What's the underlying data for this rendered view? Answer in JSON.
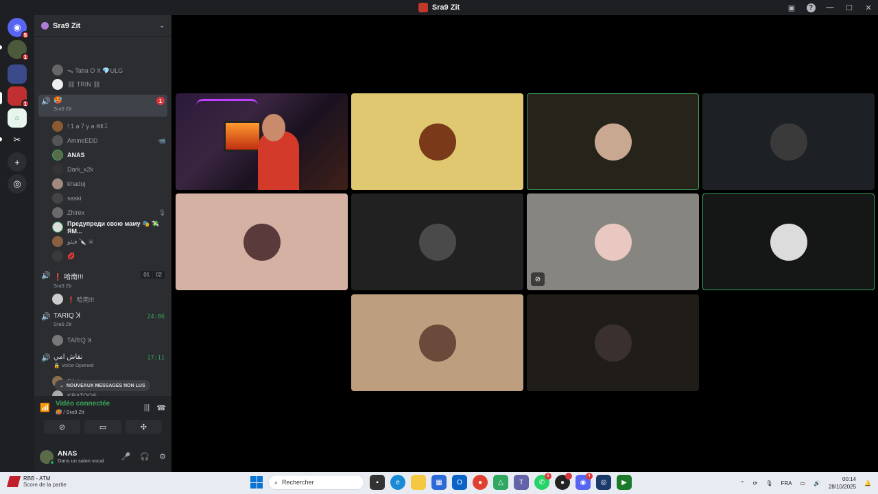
{
  "window": {
    "title": "Sra9 Zit"
  },
  "servers": {
    "items": [
      {
        "name": "discord-home-icon",
        "badge": "5",
        "color": "#5865f2"
      },
      {
        "name": "server-1",
        "badge": "1",
        "color": "#4a5a3a"
      },
      {
        "name": "server-2",
        "badge": "",
        "color": "#3b4a8a"
      },
      {
        "name": "server-3",
        "badge": "1",
        "color": "#c03030"
      },
      {
        "name": "server-4",
        "badge": "",
        "color": "#e8f5ee"
      },
      {
        "name": "server-5",
        "badge": "",
        "color": "#ffffff"
      }
    ]
  },
  "guild": {
    "name": "Sra9 Zit"
  },
  "channels": {
    "top_users": [
      {
        "name": "ᯓ Taha O X 💎ULG"
      },
      {
        "name": "⛓ TRIN ⛓"
      }
    ],
    "current": {
      "emoji": "🥵",
      "sub": "Sra9 Zit",
      "badge": "1"
    },
    "current_users": [
      {
        "name": "! 1 a 7 y a   ꕕꔪꔊ",
        "bold": false,
        "right": ""
      },
      {
        "name": "AmineEDD",
        "bold": false,
        "right": "📹"
      },
      {
        "name": "ANAS",
        "bold": true,
        "right": ""
      },
      {
        "name": "Dark_x2k",
        "bold": false,
        "right": ""
      },
      {
        "name": "khadoj",
        "bold": false,
        "right": ""
      },
      {
        "name": "saski",
        "bold": false,
        "right": ""
      },
      {
        "name": "Zhirex",
        "bold": false,
        "right": "🎙"
      },
      {
        "name": "Предупреди свою маму 🎭 💸 ЯМ...",
        "bold": true,
        "right": ""
      },
      {
        "name": "فيتو 🔪 ☠",
        "bold": false,
        "right": ""
      },
      {
        "name": "💋",
        "bold": false,
        "right": ""
      }
    ],
    "ch2": {
      "name": "❗ 哈南!!!",
      "sub": "Sra9 Zit",
      "counter": [
        "01",
        "02"
      ],
      "user": "❗ 哈南!!!"
    },
    "ch3": {
      "name": "TARIQ ꓘ",
      "sub": "Sra9 Zit",
      "time": "24:06",
      "user": "TARIQ ꓘ"
    },
    "ch4": {
      "name": "نقاش امي",
      "sub": "🔒 Voice Opened",
      "time": "17:11",
      "users": [
        "Bilal",
        "KRATOOS"
      ]
    }
  },
  "unread": {
    "label": "NOUVEAUX MESSAGES NON LUS"
  },
  "voice_panel": {
    "title": "Vidéo connectée",
    "sub": "🥵 / Sra9 Zit"
  },
  "user_panel": {
    "name": "ANAS",
    "status": "Dans un salon vocal"
  },
  "tiles": [
    {
      "type": "stream",
      "bg": "#2a1a2a",
      "avatar": "",
      "speaking": false,
      "muted": false
    },
    {
      "type": "avatar",
      "bg": "#e0c870",
      "avatar": "#7a3a1a",
      "speaking": false,
      "muted": false
    },
    {
      "type": "avatar",
      "bg": "#26231a",
      "avatar": "#c8a890",
      "speaking": true,
      "muted": false
    },
    {
      "type": "avatar",
      "bg": "#1d2024",
      "avatar": "#3a3a3a",
      "speaking": false,
      "muted": false
    },
    {
      "type": "avatar",
      "bg": "#d4b1a3",
      "avatar": "#5a3a3a",
      "speaking": false,
      "muted": false
    },
    {
      "type": "avatar",
      "bg": "#212121",
      "avatar": "#4a4a4a",
      "speaking": false,
      "muted": false
    },
    {
      "type": "avatar",
      "bg": "#878580",
      "avatar": "#e8c8c0",
      "speaking": false,
      "muted": true
    },
    {
      "type": "avatar",
      "bg": "#151716",
      "avatar": "#dcdcdc",
      "speaking": true,
      "muted": false
    },
    {
      "type": "avatar",
      "bg": "#bd9e7f",
      "avatar": "#6a4a3a",
      "speaking": false,
      "muted": false
    },
    {
      "type": "avatar",
      "bg": "#201d18",
      "avatar": "#3a3030",
      "speaking": false,
      "muted": false
    }
  ],
  "taskbar": {
    "weather_title": "RBB - ATM",
    "weather_sub": "Score de la partie",
    "search_placeholder": "Rechercher",
    "lang": "FRA",
    "time": "00:14",
    "date": "28/10/2025"
  }
}
